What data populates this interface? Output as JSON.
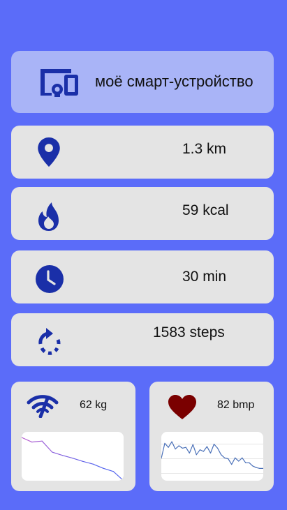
{
  "device": {
    "label": "моё смарт-устройство",
    "icon": "devices-icon"
  },
  "stats": {
    "distance": {
      "value": "1.3 km",
      "icon": "location-pin-icon"
    },
    "calories": {
      "value": "59 kcal",
      "icon": "flame-icon"
    },
    "time": {
      "value": "30 min",
      "icon": "clock-icon"
    },
    "steps": {
      "value": "1583 steps",
      "icon": "rotate-icon"
    }
  },
  "weight": {
    "value": "62 kg",
    "icon": "scale-icon",
    "chart_data": {
      "type": "line",
      "x": [
        0,
        1,
        2,
        3,
        4,
        5,
        6,
        7,
        8,
        9,
        10
      ],
      "values": [
        9.4,
        8.4,
        8.6,
        6.2,
        5.5,
        4.9,
        4.2,
        3.6,
        2.7,
        2.0,
        0.0
      ],
      "ylim": [
        0,
        10
      ],
      "colors": [
        "#b45fd0",
        "#5566ee"
      ]
    }
  },
  "heart": {
    "value": "82 bmp",
    "icon": "heart-icon",
    "chart_data": {
      "type": "line",
      "x": [
        0,
        1,
        2,
        3,
        4,
        5,
        6,
        7,
        8,
        9,
        10,
        11,
        12,
        13,
        14,
        15,
        16,
        17,
        18,
        19,
        20,
        21,
        22,
        23,
        24,
        25,
        26,
        27,
        28,
        29
      ],
      "values": [
        4.5,
        8.2,
        7.2,
        8.6,
        6.8,
        7.6,
        7.0,
        7.2,
        5.8,
        7.9,
        5.4,
        6.6,
        6.2,
        7.4,
        5.8,
        8.0,
        7.0,
        5.4,
        4.6,
        4.4,
        3.0,
        4.6,
        3.8,
        4.6,
        3.4,
        3.4,
        2.6,
        2.2,
        2.0,
        2.0
      ],
      "ylim": [
        0,
        10
      ],
      "grid": true,
      "color": "#4a70b8"
    }
  },
  "colors": {
    "background": "#5b6cf9",
    "card": "#e4e4e4",
    "accent_card": "#a9b4f7",
    "icon": "#1a2fa8",
    "heart": "#7a0000"
  }
}
